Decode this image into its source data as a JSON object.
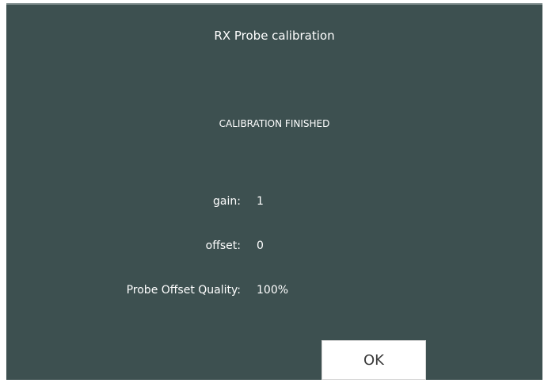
{
  "dialog": {
    "title": "RX Probe calibration",
    "status": "CALIBRATION FINISHED",
    "results": [
      {
        "label": "gain:",
        "value": "1"
      },
      {
        "label": "offset:",
        "value": "0"
      },
      {
        "label": "Probe Offset Quality:",
        "value": "100%"
      }
    ],
    "ok_label": "OK"
  },
  "colors": {
    "dialog_background": "#3d5050",
    "text": "#ffffff",
    "button_background": "#ffffff"
  }
}
